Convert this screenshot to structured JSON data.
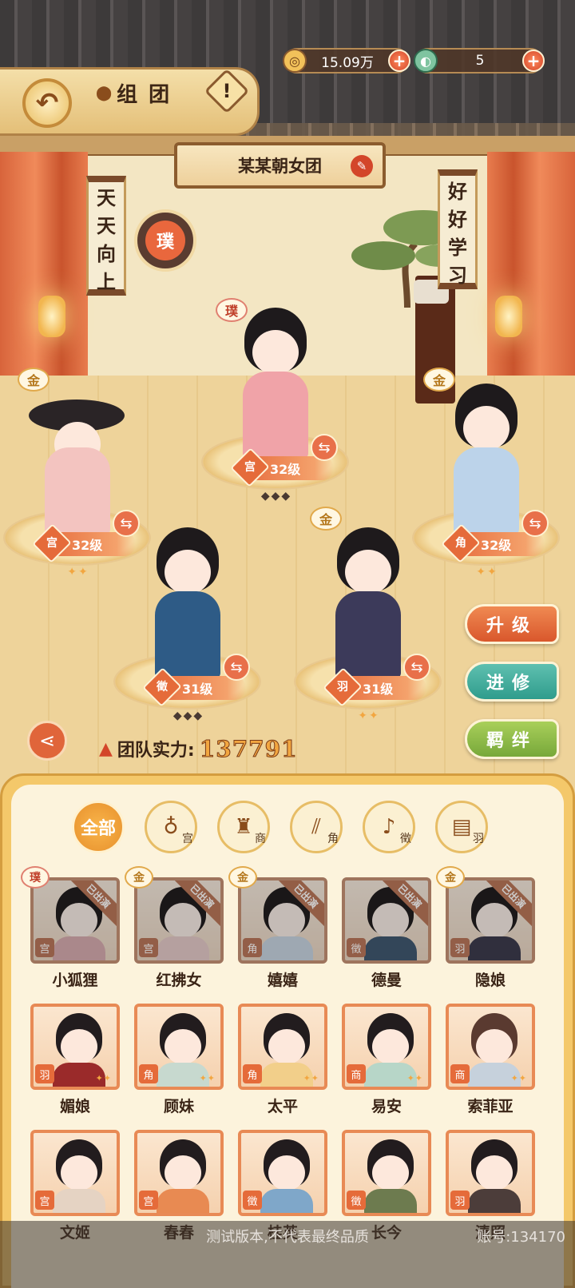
{
  "header": {
    "coins": "15.09万",
    "jade": "5",
    "title": "组团",
    "help_label": "!"
  },
  "team": {
    "name": "某某朝女团",
    "seal_label": "璞",
    "scroll_left": [
      "天",
      "天",
      "向",
      "上"
    ],
    "scroll_right": [
      "好",
      "好",
      "学",
      "习"
    ]
  },
  "lineup": [
    {
      "level": "32级",
      "rank": "璞",
      "role_icon": "宫",
      "stars": "◆◆◆",
      "cloth": "#f0a3a8"
    },
    {
      "level": "32级",
      "rank": "金",
      "role_icon": "宫",
      "stars": "✦✦",
      "cloth": "#f3c4c0"
    },
    {
      "level": "32级",
      "rank": "金",
      "role_icon": "角",
      "stars": "✦✦",
      "cloth": "#bcd3ea"
    },
    {
      "level": "31级",
      "rank": "",
      "role_icon": "徵",
      "stars": "◆◆◆",
      "cloth": "#2e5b86"
    },
    {
      "level": "31级",
      "rank": "金",
      "role_icon": "羽",
      "stars": "✦✦",
      "cloth": "#3c3a5a"
    }
  ],
  "actions": {
    "upgrade": "升级",
    "train": "进修",
    "bond": "羁绊"
  },
  "power": {
    "label": "团队实力:",
    "value": "137791"
  },
  "filters": [
    {
      "label": "全部",
      "icon": ""
    },
    {
      "label": "宫",
      "icon": "♁"
    },
    {
      "label": "商",
      "icon": "♜"
    },
    {
      "label": "角",
      "icon": "⫽"
    },
    {
      "label": "徵",
      "icon": "♪"
    },
    {
      "label": "羽",
      "icon": "▤"
    }
  ],
  "roster": [
    {
      "name": "小狐狸",
      "rank": "璞",
      "ribbon": "已出演",
      "role": "宫",
      "cloth": "#f0a3a8"
    },
    {
      "name": "红拂女",
      "rank": "金",
      "ribbon": "已出演",
      "role": "宫",
      "cloth": "#f3c4c0"
    },
    {
      "name": "嬉嬉",
      "rank": "金",
      "ribbon": "已出演",
      "role": "角",
      "cloth": "#bcd3ea"
    },
    {
      "name": "德曼",
      "rank": "",
      "ribbon": "已出演",
      "role": "徵",
      "cloth": "#2e5b86"
    },
    {
      "name": "隐娘",
      "rank": "金",
      "ribbon": "已出演",
      "role": "羽",
      "cloth": "#3c3a5a"
    },
    {
      "name": "媚娘",
      "rank": "",
      "ribbon": "",
      "role": "羽",
      "cloth": "#9a2a2a"
    },
    {
      "name": "顾妹",
      "rank": "",
      "ribbon": "",
      "role": "角",
      "cloth": "#c7d9cf"
    },
    {
      "name": "太平",
      "rank": "",
      "ribbon": "",
      "role": "角",
      "cloth": "#f2cf8a"
    },
    {
      "name": "易安",
      "rank": "",
      "ribbon": "",
      "role": "商",
      "cloth": "#b7d6c8"
    },
    {
      "name": "索菲亚",
      "rank": "",
      "ribbon": "",
      "role": "商",
      "cloth": "#c6d1dc"
    },
    {
      "name": "文姬",
      "rank": "",
      "ribbon": "",
      "role": "宫",
      "cloth": "#e5d3c3"
    },
    {
      "name": "春春",
      "rank": "",
      "ribbon": "",
      "role": "宫",
      "cloth": "#e88a52"
    },
    {
      "name": "桂英",
      "rank": "",
      "ribbon": "",
      "role": "徵",
      "cloth": "#7fa7c9"
    },
    {
      "name": "长今",
      "rank": "",
      "ribbon": "",
      "role": "徵",
      "cloth": "#6d7b4f"
    },
    {
      "name": "清照",
      "rank": "",
      "ribbon": "",
      "role": "羽",
      "cloth": "#4c3d3a"
    }
  ],
  "footer": {
    "notice": "测试版本,不代表最终品质",
    "account": "账号:134170"
  }
}
